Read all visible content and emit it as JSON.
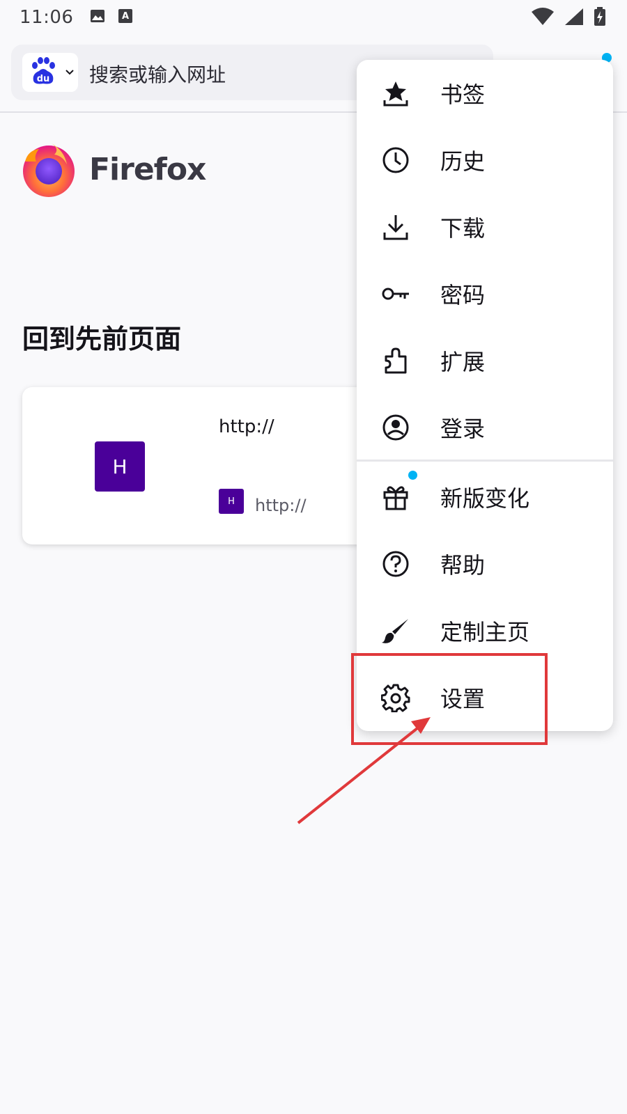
{
  "status_bar": {
    "time": "11:06",
    "left_icons": [
      "image-icon",
      "font-download-icon"
    ],
    "right_icons": [
      "wifi-icon",
      "signal-icon",
      "battery-charging-icon"
    ]
  },
  "toolbar": {
    "search_placeholder": "搜索或输入网址",
    "search_engine_icon": "baidu-logo-icon"
  },
  "home": {
    "brand": "Firefox",
    "section_title": "回到先前页面",
    "recent_tab": {
      "thumb_letter": "H",
      "title": "http://",
      "favicon_letter": "H",
      "url": "http://"
    }
  },
  "menu": {
    "items": [
      {
        "label": "书签",
        "icon": "bookmark-star-icon"
      },
      {
        "label": "历史",
        "icon": "clock-icon"
      },
      {
        "label": "下载",
        "icon": "download-icon"
      },
      {
        "label": "密码",
        "icon": "key-icon"
      },
      {
        "label": "扩展",
        "icon": "puzzle-icon"
      },
      {
        "label": "登录",
        "icon": "account-icon"
      },
      {
        "label": "新版变化",
        "icon": "gift-icon"
      },
      {
        "label": "帮助",
        "icon": "help-icon"
      },
      {
        "label": "定制主页",
        "icon": "brush-icon"
      },
      {
        "label": "设置",
        "icon": "gear-icon"
      }
    ]
  },
  "colors": {
    "accent_dot": "#00b3f4",
    "tab_thumb": "#4a0099",
    "annotation": "#e0393b"
  }
}
